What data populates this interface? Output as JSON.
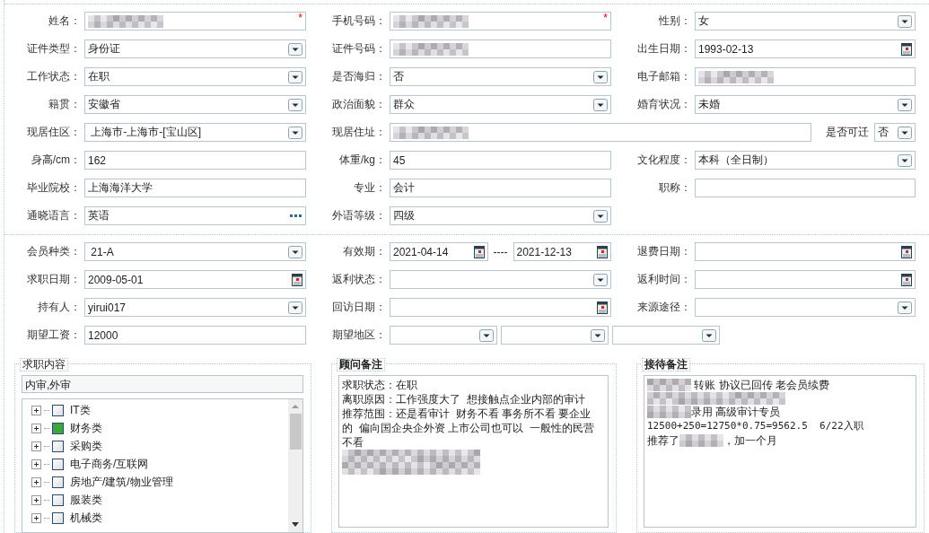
{
  "sections": [
    {
      "rows": [
        {
          "cells": [
            {
              "label": "姓名：",
              "controls": [
                {
                  "kind": "text",
                  "redacted": true,
                  "required_mark": "*"
                }
              ]
            },
            {
              "label": "手机号码：",
              "controls": [
                {
                  "kind": "text",
                  "redacted": true,
                  "required_mark": "*"
                }
              ]
            },
            {
              "label": "性别：",
              "controls": [
                {
                  "kind": "select",
                  "value": "女"
                }
              ]
            }
          ]
        },
        {
          "cells": [
            {
              "label": "证件类型：",
              "controls": [
                {
                  "kind": "select",
                  "value": "身份证"
                }
              ]
            },
            {
              "label": "证件号码：",
              "controls": [
                {
                  "kind": "text",
                  "redacted": true
                }
              ]
            },
            {
              "label": "出生日期：",
              "controls": [
                {
                  "kind": "date",
                  "value": "1993-02-13"
                }
              ]
            }
          ]
        },
        {
          "cells": [
            {
              "label": "工作状态：",
              "controls": [
                {
                  "kind": "select",
                  "value": "在职"
                }
              ]
            },
            {
              "label": "是否海归：",
              "controls": [
                {
                  "kind": "select",
                  "value": "否"
                }
              ]
            },
            {
              "label": "电子邮箱：",
              "controls": [
                {
                  "kind": "text",
                  "redacted": true
                }
              ]
            }
          ]
        },
        {
          "cells": [
            {
              "label": "籍贯：",
              "controls": [
                {
                  "kind": "select",
                  "value": "安徽省"
                }
              ]
            },
            {
              "label": "政治面貌：",
              "controls": [
                {
                  "kind": "select",
                  "value": "群众"
                }
              ]
            },
            {
              "label": "婚育状况：",
              "controls": [
                {
                  "kind": "select",
                  "value": "未婚"
                }
              ]
            }
          ]
        },
        {
          "cells": [
            {
              "label": "现居住区：",
              "controls": [
                {
                  "kind": "select",
                  "value": " 上海市-上海市-[宝山区]"
                }
              ]
            },
            {
              "label": "现居住址：",
              "controls": [
                {
                  "kind": "text",
                  "redacted": true
                },
                {
                  "kind": "inline_label",
                  "text": "是否可迁"
                },
                {
                  "kind": "select",
                  "value": "否"
                }
              ]
            }
          ]
        },
        {
          "cells": [
            {
              "label": "身高/cm：",
              "controls": [
                {
                  "kind": "text",
                  "value": "162"
                }
              ]
            },
            {
              "label": "体重/kg：",
              "controls": [
                {
                  "kind": "text",
                  "value": "45"
                }
              ]
            },
            {
              "label": "文化程度：",
              "controls": [
                {
                  "kind": "select",
                  "value": "本科（全日制）"
                }
              ]
            }
          ]
        },
        {
          "cells": [
            {
              "label": "毕业院校：",
              "controls": [
                {
                  "kind": "text",
                  "value": "上海海洋大学"
                }
              ]
            },
            {
              "label": "专业：",
              "controls": [
                {
                  "kind": "text",
                  "value": "会计"
                }
              ]
            },
            {
              "label": "职称：",
              "controls": [
                {
                  "kind": "text"
                }
              ]
            }
          ]
        },
        {
          "cells": [
            {
              "label": "通晓语言：",
              "controls": [
                {
                  "kind": "lookup",
                  "value": "英语"
                }
              ]
            },
            {
              "label": "外语等级：",
              "controls": [
                {
                  "kind": "select",
                  "value": "四级"
                }
              ]
            }
          ]
        }
      ]
    },
    {
      "rows": [
        {
          "cells": [
            {
              "label": "会员种类：",
              "controls": [
                {
                  "kind": "select",
                  "value": " 21-A"
                }
              ]
            },
            {
              "label": "有效期：",
              "controls": [
                {
                  "kind": "date",
                  "value": "2021-04-14"
                },
                {
                  "kind": "dash",
                  "text": "----"
                },
                {
                  "kind": "date",
                  "value": "2021-12-13"
                }
              ]
            },
            {
              "label": "退费日期：",
              "controls": [
                {
                  "kind": "date"
                }
              ]
            }
          ]
        },
        {
          "cells": [
            {
              "label": "求职日期：",
              "controls": [
                {
                  "kind": "date",
                  "value": "2009-05-01"
                }
              ]
            },
            {
              "label": "返利状态：",
              "controls": [
                {
                  "kind": "select"
                }
              ]
            },
            {
              "label": "返利时间：",
              "controls": [
                {
                  "kind": "date"
                }
              ]
            }
          ]
        },
        {
          "cells": [
            {
              "label": "持有人：",
              "controls": [
                {
                  "kind": "select",
                  "value": "yirui017"
                }
              ]
            },
            {
              "label": "回访日期：",
              "controls": [
                {
                  "kind": "date"
                }
              ]
            },
            {
              "label": "来源途径：",
              "controls": [
                {
                  "kind": "select"
                }
              ]
            }
          ]
        },
        {
          "cells": [
            {
              "label": "期望工资：",
              "controls": [
                {
                  "kind": "text",
                  "value": "12000"
                }
              ]
            },
            {
              "label": "期望地区：",
              "controls": [
                {
                  "kind": "select"
                },
                {
                  "kind": "select"
                },
                {
                  "kind": "select"
                }
              ]
            }
          ]
        }
      ]
    }
  ],
  "panels": [
    {
      "kind": "tree",
      "title": "求职内容",
      "filter": "内审,外审",
      "items": [
        {
          "label": "IT类",
          "checked": false,
          "expanded": false
        },
        {
          "label": "财务类",
          "checked": true,
          "expanded": false
        },
        {
          "label": "采购类",
          "checked": false,
          "expanded": false
        },
        {
          "label": "电子商务/互联网",
          "checked": false,
          "expanded": false
        },
        {
          "label": "房地产/建筑/物业管理",
          "checked": false,
          "expanded": false
        },
        {
          "label": "服装类",
          "checked": false,
          "expanded": false
        },
        {
          "label": "机械类",
          "checked": false,
          "expanded": false
        }
      ]
    },
    {
      "kind": "notes",
      "title": "顾问备注",
      "lines": [
        {
          "segments": [
            {
              "kind": "text",
              "text": "求职状态：在职"
            }
          ]
        },
        {
          "segments": [
            {
              "kind": "text",
              "text": "离职原因：工作强度大了  想接触点企业内部的审计"
            }
          ]
        },
        {
          "segments": [
            {
              "kind": "text",
              "text": "推荐范围：还是看审计  财务不看 事务所不看 要企业的  偏向国企央企外资 上市公司也可以  一般性的民营不看"
            }
          ]
        },
        {
          "segments": [
            {
              "kind": "blur_long"
            },
            {
              "kind": "blur_long"
            }
          ]
        }
      ]
    },
    {
      "kind": "notes",
      "title": "接待备注",
      "lines": [
        {
          "segments": [
            {
              "kind": "blur"
            },
            {
              "kind": "text",
              "text": " 转账 协议已回传 老会员续费"
            }
          ]
        },
        {
          "segments": [
            {
              "kind": "blur_long"
            }
          ]
        },
        {
          "segments": [
            {
              "kind": "blur"
            },
            {
              "kind": "text",
              "text": "录用 高级审计专员"
            }
          ]
        },
        {
          "segments": [
            {
              "kind": "mono",
              "text": "12500+250=12750*0.75=9562.5  6/22入职"
            }
          ]
        },
        {
          "segments": [
            {
              "kind": "text",
              "text": "推荐了"
            },
            {
              "kind": "blur"
            },
            {
              "kind": "text",
              "text": "，加一个月"
            }
          ]
        }
      ]
    }
  ]
}
